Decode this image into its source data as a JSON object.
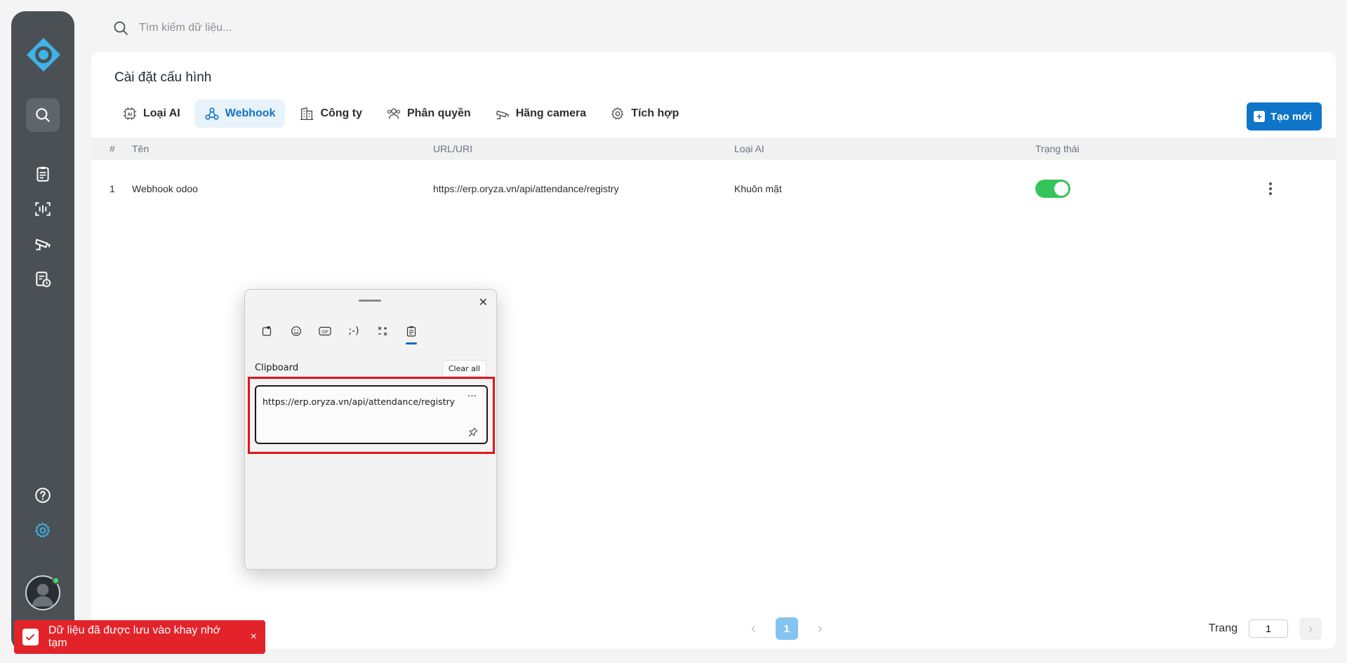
{
  "search": {
    "placeholder": "Tìm kiếm dữ liệu..."
  },
  "page": {
    "title": "Cài đặt cấu hình"
  },
  "tabs": [
    {
      "label": "Loại AI",
      "icon": "ai-chip-icon",
      "active": false
    },
    {
      "label": "Webhook",
      "icon": "webhook-icon",
      "active": true
    },
    {
      "label": "Công ty",
      "icon": "building-icon",
      "active": false
    },
    {
      "label": "Phân quyền",
      "icon": "users-group-icon",
      "active": false
    },
    {
      "label": "Hãng camera",
      "icon": "camera-icon",
      "active": false
    },
    {
      "label": "Tích hợp",
      "icon": "integration-icon",
      "active": false
    }
  ],
  "create_button": {
    "label": "Tạo mới"
  },
  "table": {
    "headers": {
      "index": "#",
      "name": "Tên",
      "url": "URL/URI",
      "ai_type": "Loại AI",
      "status": "Trạng thái"
    },
    "rows": [
      {
        "index": "1",
        "name": "Webhook odoo",
        "url": "https://erp.oryza.vn/api/attendance/registry",
        "ai_type": "Khuôn mặt",
        "enabled": true
      }
    ]
  },
  "pagination": {
    "current_page": "1",
    "page_label": "Trang",
    "page_input": "1"
  },
  "clipboard_popup": {
    "section_title": "Clipboard",
    "clear_all_label": "Clear all",
    "item_text": "https://erp.oryza.vn/api/attendance/registry",
    "more_label": "···"
  },
  "toast": {
    "message": "Dữ liệu đã được lưu vào khay nhớ tạm",
    "close": "×"
  },
  "colors": {
    "sidebar": "#4b5055",
    "accent": "#0e75c8",
    "toggle_on": "#34c55a",
    "toast": "#e3232a"
  }
}
